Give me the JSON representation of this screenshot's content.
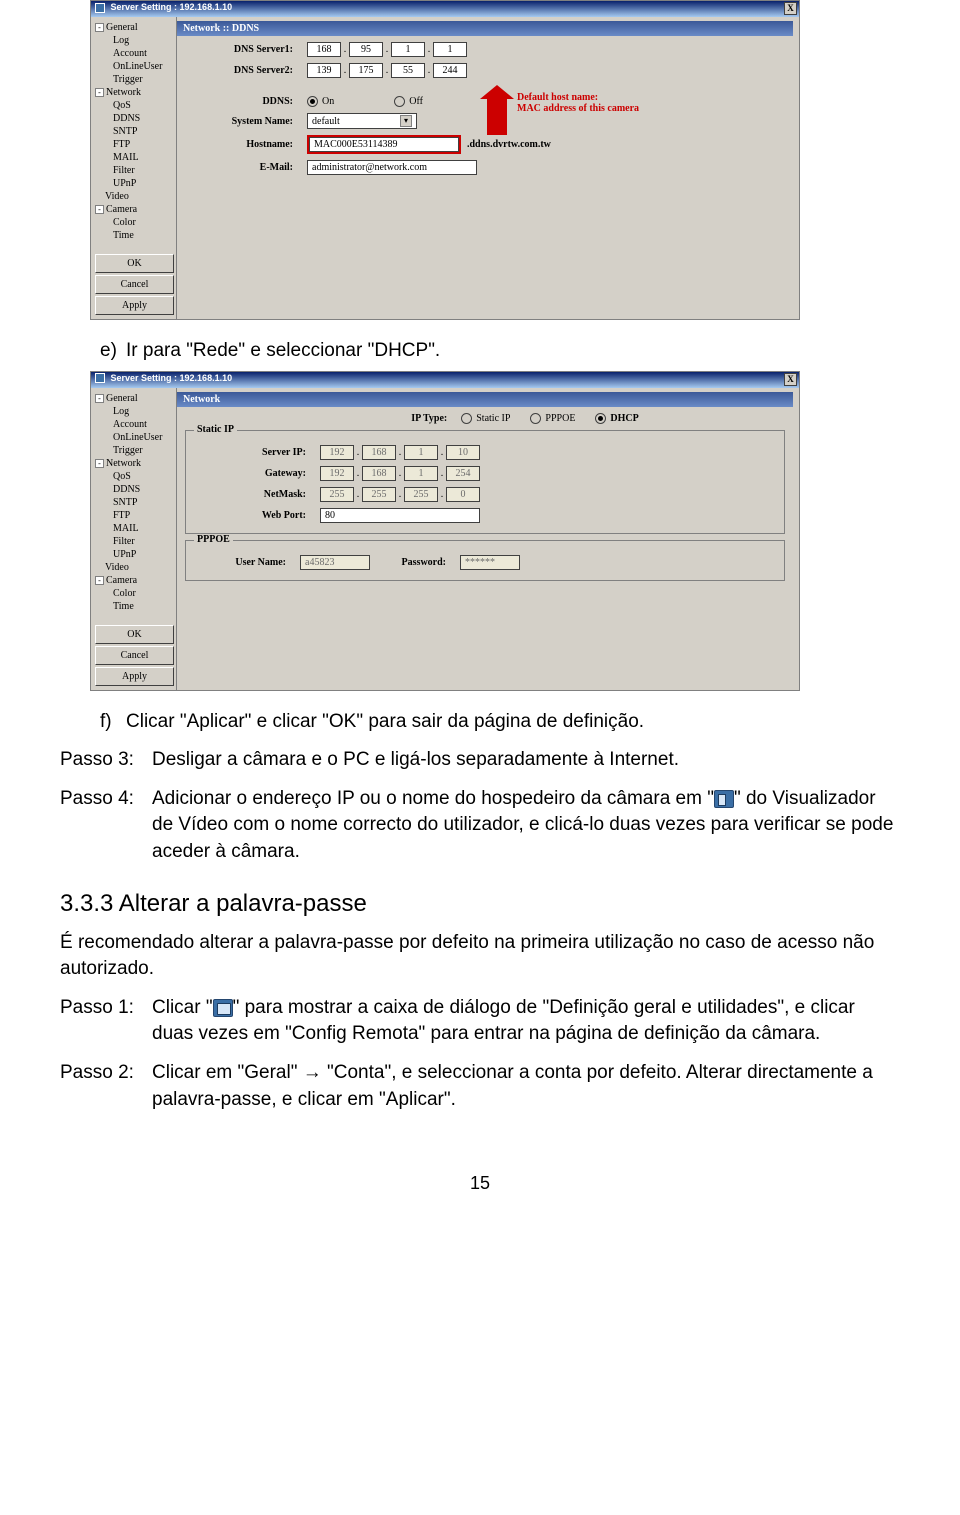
{
  "dialog1": {
    "title": "Server Setting : 192.168.1.10",
    "close": "X",
    "tree": {
      "general": "General",
      "log": "Log",
      "account": "Account",
      "onlineuser": "OnLineUser",
      "trigger": "Trigger",
      "network": "Network",
      "qos": "QoS",
      "ddns": "DDNS",
      "sntp": "SNTP",
      "ftp": "FTP",
      "mail": "MAIL",
      "filter": "Filter",
      "upnp": "UPnP",
      "video": "Video",
      "camera": "Camera",
      "color": "Color",
      "time": "Time",
      "ok": "OK",
      "cancel": "Cancel",
      "apply": "Apply"
    },
    "panel_title": "Network :: DDNS",
    "labels": {
      "dns1": "DNS Server1:",
      "dns2": "DNS Server2:",
      "ddns": "DDNS:",
      "on": "On",
      "off": "Off",
      "sysname": "System Name:",
      "hostname": "Hostname:",
      "email": "E-Mail:"
    },
    "dns1": [
      "168",
      "95",
      "1",
      "1"
    ],
    "dns2": [
      "139",
      "175",
      "55",
      "244"
    ],
    "ddns_on": true,
    "sysname_value": "default",
    "hostname_value": "MAC000E53114389",
    "hostname_suffix": ".ddns.dvrtw.com.tw",
    "email_value": "administrator@network.com",
    "annot1": "Default host name:",
    "annot2": "MAC address of this camera"
  },
  "dialog2": {
    "title": "Server Setting : 192.168.1.10",
    "close": "X",
    "tree": {
      "general": "General",
      "log": "Log",
      "account": "Account",
      "onlineuser": "OnLineUser",
      "trigger": "Trigger",
      "network": "Network",
      "qos": "QoS",
      "ddns": "DDNS",
      "sntp": "SNTP",
      "ftp": "FTP",
      "mail": "MAIL",
      "filter": "Filter",
      "upnp": "UPnP",
      "video": "Video",
      "camera": "Camera",
      "color": "Color",
      "time": "Time",
      "ok": "OK",
      "cancel": "Cancel",
      "apply": "Apply"
    },
    "panel_title": "Network",
    "labels": {
      "iptype": "IP Type:",
      "static": "Static IP",
      "pppoe": "PPPOE",
      "dhcp": "DHCP",
      "group_static": "Static IP",
      "serverip": "Server IP:",
      "gateway": "Gateway:",
      "netmask": "NetMask:",
      "webport": "Web Port:",
      "group_pppoe": "PPPOE",
      "username": "User Name:",
      "password": "Password:"
    },
    "iptype_sel": "DHCP",
    "serverip": [
      "192",
      "168",
      "1",
      "10"
    ],
    "gateway": [
      "192",
      "168",
      "1",
      "254"
    ],
    "netmask": [
      "255",
      "255",
      "255",
      "0"
    ],
    "webport": "80",
    "pppoe_user": "a45823",
    "pppoe_pass": "******"
  },
  "doc": {
    "li_e_mk": "e)",
    "li_e": "Ir para \"Rede\" e seleccionar \"DHCP\".",
    "li_f_mk": "f)",
    "li_f": "Clicar \"Aplicar\" e clicar \"OK\" para sair da página de definição.",
    "p3_label": "Passo 3:",
    "p3_body": "Desligar a câmara e o PC e ligá-los separadamente à Internet.",
    "p4_label": "Passo 4:",
    "p4_body_a": "Adicionar o endereço IP ou o nome do hospedeiro da câmara em \"",
    "p4_body_b": "\" do Visualizador de Vídeo com o nome correcto do utilizador, e clicá-lo duas vezes para verificar se pode aceder à câmara.",
    "sec_title": "3.3.3 Alterar a palavra-passe",
    "para1": "É recomendado alterar a palavra-passe por defeito na primeira utilização no caso de acesso não autorizado.",
    "s1_label": "Passo 1:",
    "s1_a": "Clicar \"",
    "s1_b": "\" para mostrar a caixa de diálogo de \"Definição geral e utilidades\", e clicar duas vezes em \"Config Remota\" para entrar na página de definição da câmara.",
    "s2_label": "Passo 2:",
    "s2": "Clicar em \"Geral\" → \"Conta\", e seleccionar a conta por defeito. Alterar directamente a palavra-passe, e clicar em \"Aplicar\".",
    "pagenum": "15"
  }
}
